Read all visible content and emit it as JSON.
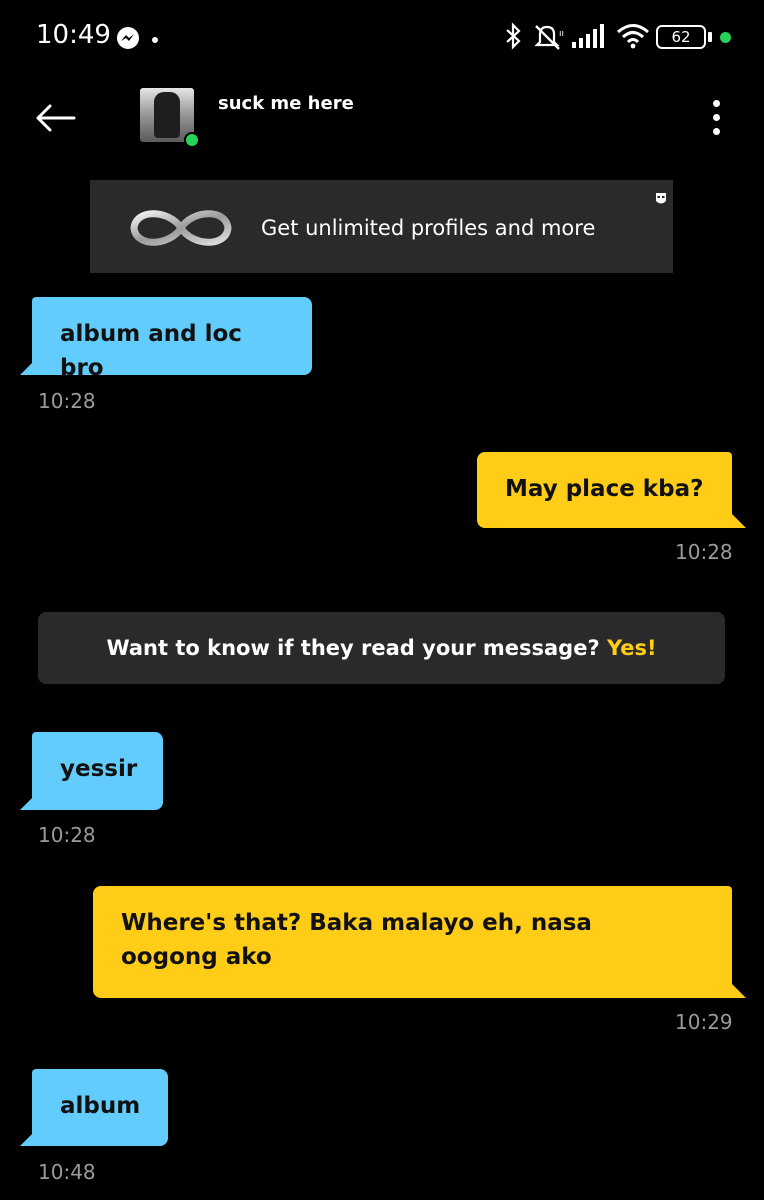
{
  "status_bar": {
    "time": "10:49",
    "battery": "62",
    "icons": [
      "messenger-icon",
      "bluetooth-icon",
      "mute-icon",
      "signal-icon",
      "wifi-icon",
      "battery-icon"
    ]
  },
  "header": {
    "contact_name": "suck me here",
    "online": true
  },
  "promo": {
    "text": "Get unlimited profiles and more"
  },
  "messages": [
    {
      "direction": "in",
      "text": "album and loc bro",
      "time": "10:28"
    },
    {
      "direction": "out",
      "text": "May place kba?",
      "time": "10:28"
    },
    {
      "direction": "in",
      "text": "yessir",
      "time": "10:28"
    },
    {
      "direction": "out",
      "text": "Where's that? Baka malayo eh, nasa oogong ako",
      "time": "10:29"
    },
    {
      "direction": "in",
      "text": "album",
      "time": "10:48"
    }
  ],
  "read_receipt_banner": {
    "text": "Want to know if they read your message?",
    "cta": "Yes!"
  },
  "colors": {
    "incoming_bubble": "#62cdfc",
    "outgoing_bubble": "#ffcc17",
    "online": "#27d35b",
    "banner_bg": "#2a2a2c"
  }
}
